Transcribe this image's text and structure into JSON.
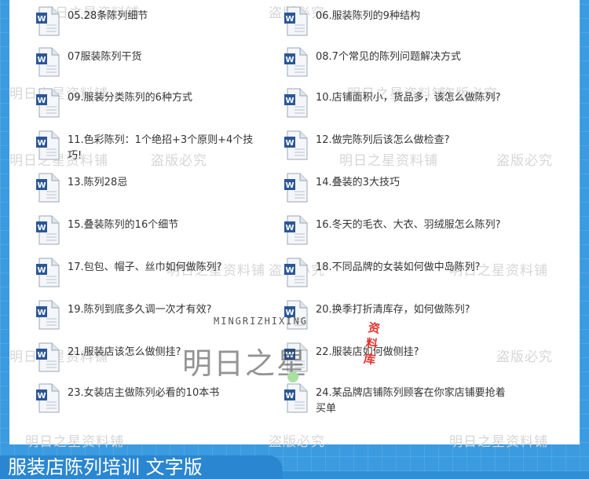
{
  "items": [
    {
      "label": "05.28条陈列细节",
      "icon": "word-doc-icon"
    },
    {
      "label": "06.服装陈列的9种结构",
      "icon": "word-doc-icon"
    },
    {
      "label": "07服装陈列干货",
      "icon": "word-doc-icon"
    },
    {
      "label": "08.7个常见的陈列问题解决方式",
      "icon": "word-doc-icon"
    },
    {
      "label": "09.服装分类陈列的6种方式",
      "icon": "word-doc-icon"
    },
    {
      "label": "10.店铺面积小，货品多，该怎么做陈列?",
      "icon": "word-doc-icon"
    },
    {
      "label": "11.色彩陈列：1个绝招+3个原则+4个技巧!",
      "icon": "word-doc-icon"
    },
    {
      "label": "12.做完陈列后该怎么做检查?",
      "icon": "word-doc-icon"
    },
    {
      "label": "13.陈列28忌",
      "icon": "word-doc-icon"
    },
    {
      "label": "14.叠装的3大技巧",
      "icon": "word-doc-icon"
    },
    {
      "label": "15.叠装陈列的16个细节",
      "icon": "word-doc-icon"
    },
    {
      "label": "16.冬天的毛衣、大衣、羽绒服怎么陈列?",
      "icon": "word-doc-icon"
    },
    {
      "label": "17.包包、帽子、丝巾如何做陈列?",
      "icon": "word-doc-icon"
    },
    {
      "label": "18.不同品牌的女装如何做中岛陈列?",
      "icon": "word-doc-icon"
    },
    {
      "label": "19.陈列到底多久调一次才有效?",
      "icon": "word-doc-icon"
    },
    {
      "label": "20.换季打折清库存，如何做陈列?",
      "icon": "word-doc-icon"
    },
    {
      "label": "21.服装店该怎么做侧挂?",
      "icon": "word-doc-icon"
    },
    {
      "label": "22.服装店如何做侧挂?",
      "icon": "word-doc-icon"
    },
    {
      "label": "23.女装店主做陈列必看的10本书",
      "icon": "word-doc-icon"
    },
    {
      "label": "24.某品牌店铺陈列顾客在你家店铺要抢着买单",
      "icon": "word-doc-icon"
    }
  ],
  "watermarks": [
    "明日之星资料铺",
    "盗版必究"
  ],
  "logo": {
    "en": "MINGRIZHIXING",
    "cn": "明日之星",
    "stamp": "资料库"
  },
  "footer": {
    "title": "服装店陈列培训 文字版"
  },
  "colors": {
    "frame": "#3b9be0",
    "word_blue": "#2b5797",
    "stamp": "#e0352f"
  }
}
